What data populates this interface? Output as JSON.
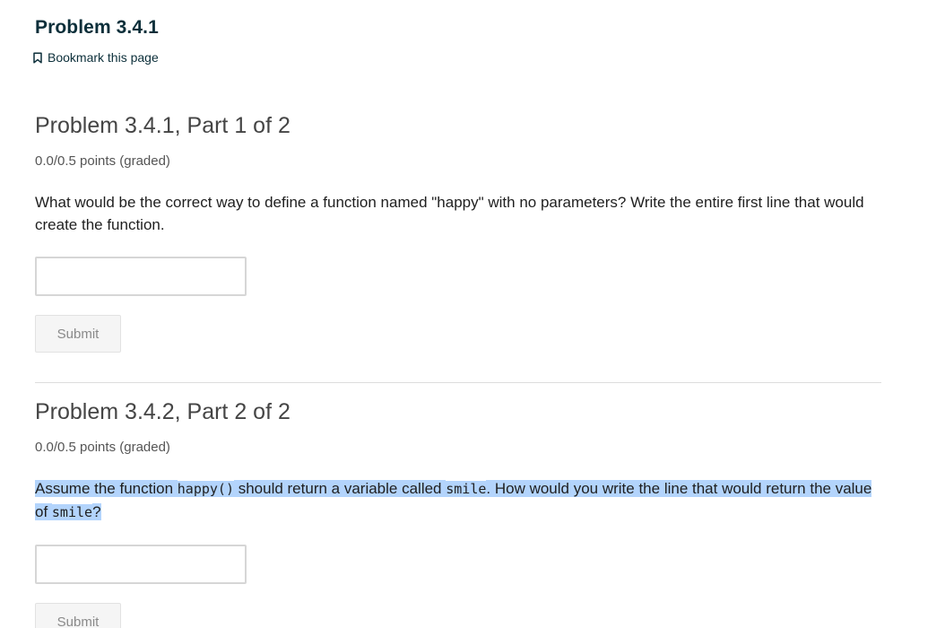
{
  "unit": {
    "title": "Problem 3.4.1",
    "bookmark_label": "Bookmark this page"
  },
  "problems": [
    {
      "title": "Problem 3.4.1, Part 1 of 2",
      "points": "0.0/0.5 points (graded)",
      "question": "What would be the correct way to define a function named \"happy\" with no parameters? Write the entire first line that would create the function.",
      "answer_value": "",
      "submit_label": "Submit"
    },
    {
      "title": "Problem 3.4.2, Part 2 of 2",
      "points": "0.0/0.5 points (graded)",
      "question_parts": {
        "p1": "Assume the function ",
        "code1": "happy()",
        "p2": " should return a variable called ",
        "code2": "smile",
        "p3": ". How would you write the line that would return the value of ",
        "code3": "smile",
        "p4": "?"
      },
      "answer_value": "",
      "submit_label": "Submit"
    }
  ],
  "colors": {
    "heading": "#0c2f3a",
    "selection_highlight": "#b3d4fc",
    "submit_disabled_text": "#8a8a8a"
  },
  "icons": {
    "bookmark": "bookmark-outline-icon"
  }
}
